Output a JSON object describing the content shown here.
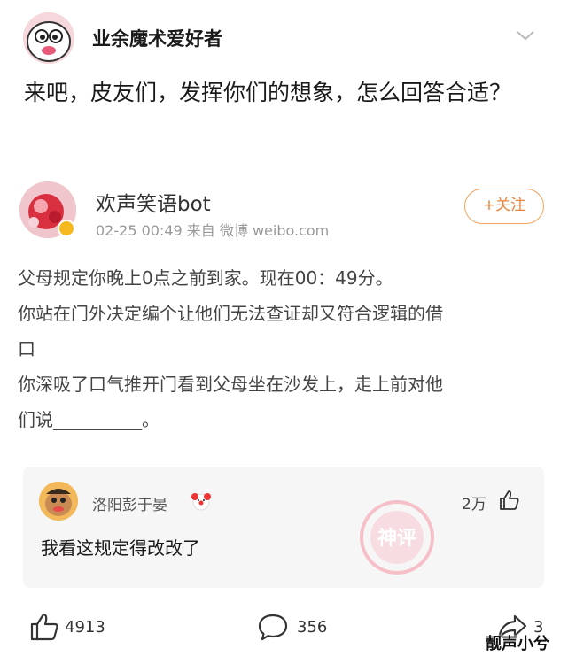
{
  "post": {
    "author": "业余魔术爱好者",
    "text": "来吧，皮友们，发挥你们的想象，怎么回答合适？"
  },
  "repost": {
    "author": "欢声笑语bot",
    "meta": "02-25 00:49  来自 微博 weibo.com",
    "follow_label": "+关注",
    "lines": [
      "父母规定你晚上0点之前到家。现在00：49分。",
      "你站在门外决定编个让他们无法查证却又符合逻辑的借",
      "口",
      "你深吸了口气推开门看到父母坐在沙发上，走上前对他",
      "们说__________。"
    ]
  },
  "comment": {
    "author": "洛阳彭于晏",
    "likes": "2万",
    "text": "我看这规定得改改了",
    "stamp_text": "神评"
  },
  "actions": {
    "likes": "4913",
    "comments": "356",
    "shares": "3"
  },
  "watermark": "靓声小兮",
  "colors": {
    "accent": "#e8823a",
    "badge": "#f5b81f",
    "card_bg": "#f6f6f6"
  }
}
